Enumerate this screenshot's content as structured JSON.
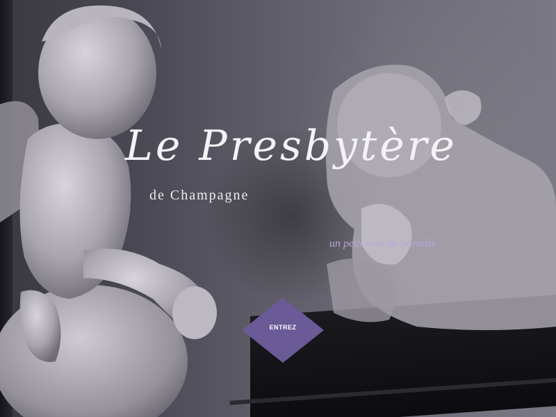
{
  "brand": {
    "title": "Le Presbytère",
    "subtitle": "de Champagne",
    "tagline": "un petit coin de paradis"
  },
  "enter_button": {
    "label": "ENTREZ"
  },
  "colors": {
    "accent": "#6a5a97",
    "tagline": "#b9a6d9",
    "title": "#f4f2f6"
  }
}
